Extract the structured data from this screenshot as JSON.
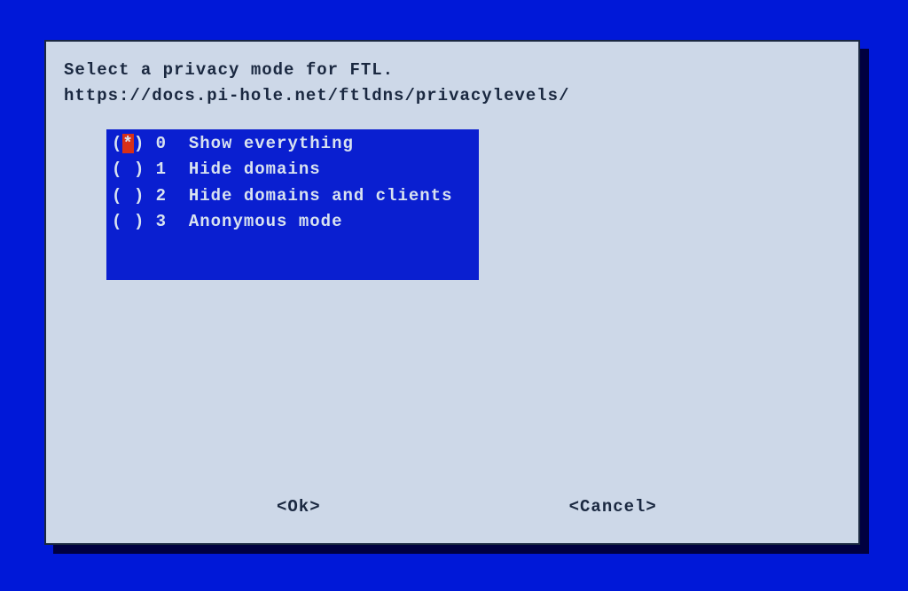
{
  "header": {
    "line1": "Select a privacy mode for FTL.",
    "line2": "https://docs.pi-hole.net/ftldns/privacylevels/"
  },
  "options": [
    {
      "mark": "*",
      "num": "0",
      "label": "Show everything",
      "selected": true
    },
    {
      "mark": " ",
      "num": "1",
      "label": "Hide domains",
      "selected": false
    },
    {
      "mark": " ",
      "num": "2",
      "label": "Hide domains and clients",
      "selected": false
    },
    {
      "mark": " ",
      "num": "3",
      "label": "Anonymous mode",
      "selected": false
    }
  ],
  "buttons": {
    "ok": "<Ok>",
    "cancel": "<Cancel>"
  }
}
